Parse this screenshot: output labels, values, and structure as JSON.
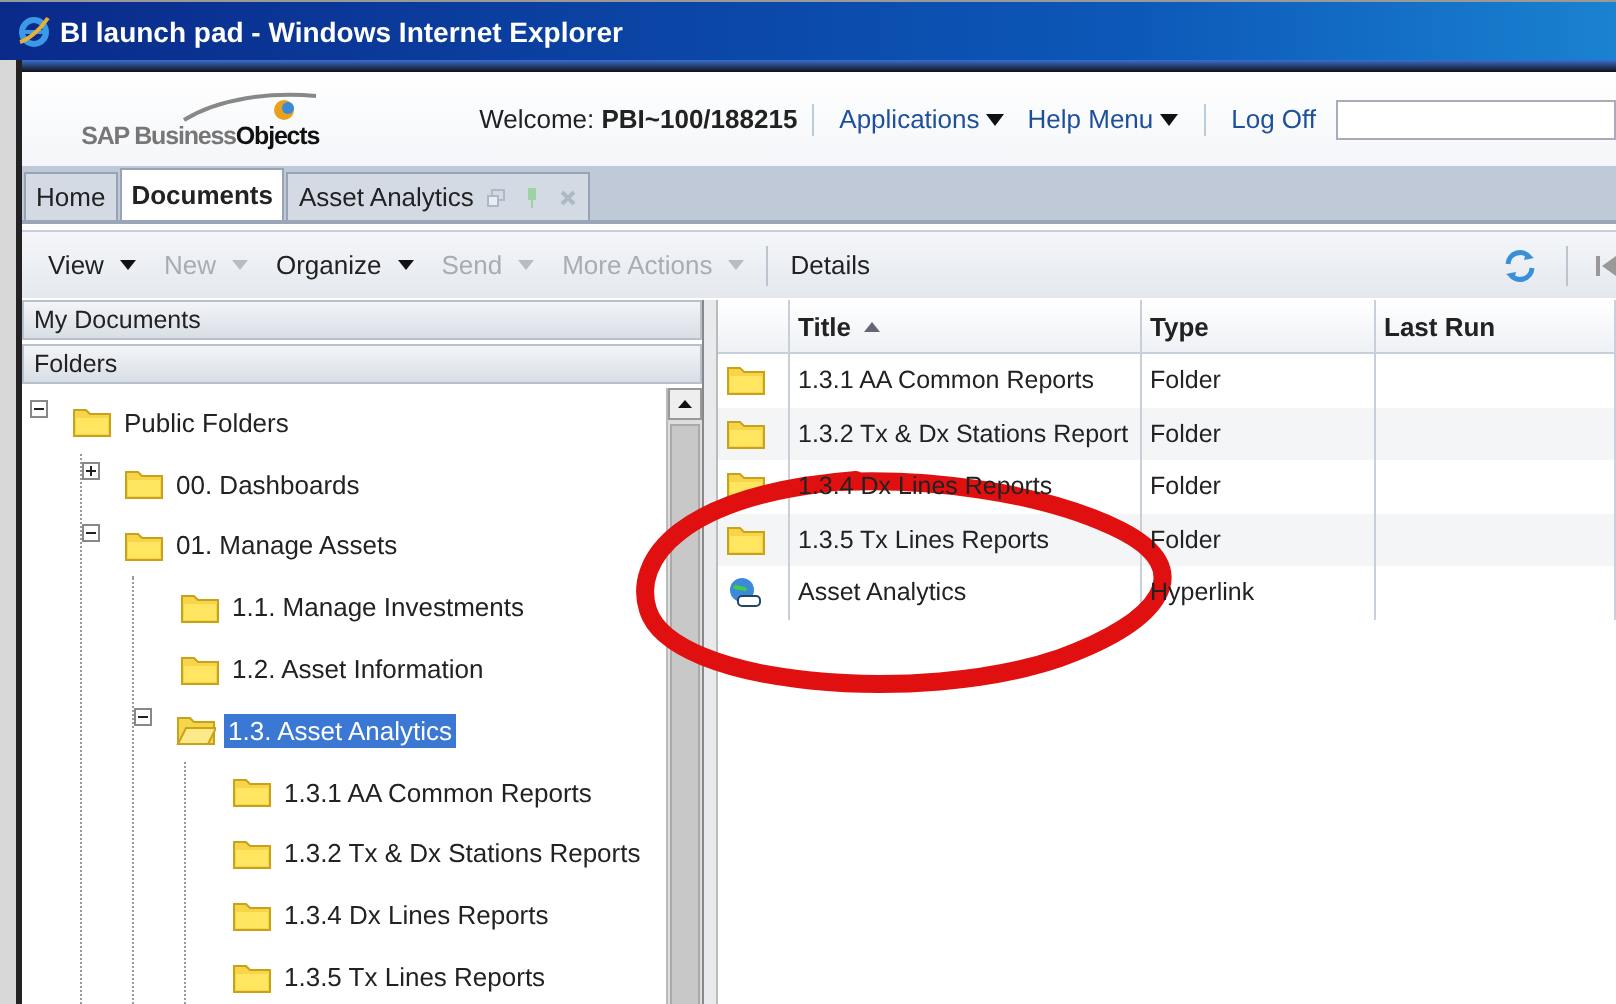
{
  "window": {
    "title": "BI launch pad - Windows Internet Explorer"
  },
  "header": {
    "logo": "SAP Business**Objects**",
    "welcome": "Welcome: **PBI~100/188215**",
    "links": [
      {
        "label": "Applications",
        "dropdown": true
      },
      {
        "label": "Help Menu",
        "dropdown": true
      },
      {
        "label": "Log Off",
        "dropdown": false
      }
    ]
  },
  "tabs": [
    {
      "label": "Home",
      "selected": false,
      "closable": false
    },
    {
      "label": "Documents",
      "selected": true,
      "closable": false
    },
    {
      "label": "Asset Analytics",
      "selected": false,
      "closable": true
    }
  ],
  "toolbar": {
    "items": [
      {
        "label": "View",
        "disabled": false,
        "dropdown": true
      },
      {
        "label": "New",
        "disabled": true,
        "dropdown": true
      },
      {
        "label": "Organize",
        "disabled": false,
        "dropdown": true
      },
      {
        "label": "Send",
        "disabled": true,
        "dropdown": true
      },
      {
        "label": "More Actions",
        "disabled": true,
        "dropdown": true
      },
      {
        "label": "Details",
        "disabled": false,
        "dropdown": false
      }
    ]
  },
  "sidebar": {
    "sections": [
      "My Documents",
      "Folders"
    ],
    "tree": [
      {
        "label": "Public Folders",
        "kind": "branch",
        "expanded": true,
        "selected": false,
        "children": [
          {
            "label": "00. Dashboards",
            "kind": "branch",
            "expanded": false,
            "selected": false
          },
          {
            "label": "01. Manage Assets",
            "kind": "branch",
            "expanded": true,
            "selected": false,
            "children": [
              {
                "label": "1.1. Manage Investments",
                "kind": "leaf",
                "selected": false
              },
              {
                "label": "1.2. Asset Information",
                "kind": "leaf",
                "selected": false
              },
              {
                "label": "1.3. Asset Analytics",
                "kind": "branch",
                "expanded": true,
                "selected": true,
                "children": [
                  {
                    "label": "1.3.1 AA Common Reports",
                    "kind": "leaf",
                    "selected": false
                  },
                  {
                    "label": "1.3.2 Tx & Dx Stations Reports",
                    "kind": "leaf",
                    "selected": false
                  },
                  {
                    "label": "1.3.4 Dx Lines Reports",
                    "kind": "leaf",
                    "selected": false
                  },
                  {
                    "label": "1.3.5 Tx Lines Reports",
                    "kind": "leaf",
                    "selected": false
                  }
                ]
              }
            ]
          }
        ]
      }
    ]
  },
  "table": {
    "columns": [
      {
        "label": "Title",
        "sorted": true
      },
      {
        "label": "Type",
        "sorted": false
      },
      {
        "label": "Last Run",
        "sorted": false
      }
    ],
    "rows": [
      {
        "kind": "folder",
        "title": "1.3.1 AA Common Reports",
        "type": "Folder"
      },
      {
        "kind": "folder",
        "title": "1.3.2 Tx & Dx Stations Report",
        "type": "Folder"
      },
      {
        "kind": "folder",
        "title": "1.3.4 Dx Lines Reports",
        "type": "Folder"
      },
      {
        "kind": "folder",
        "title": "1.3.5 Tx Lines Reports",
        "type": "Folder"
      },
      {
        "kind": "hyperlink",
        "title": "Asset Analytics",
        "type": "Hyperlink"
      }
    ]
  }
}
